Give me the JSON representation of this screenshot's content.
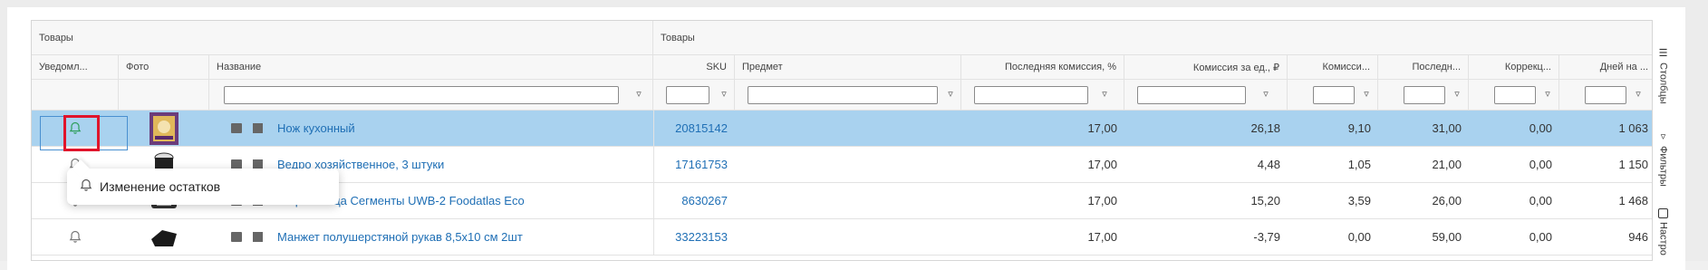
{
  "groups": {
    "left": "Товары",
    "right": "Товары"
  },
  "columns": {
    "notify": "Уведомл...",
    "photo": "Фото",
    "name": "Название",
    "sku": "SKU",
    "subject": "Предмет",
    "last_commission": "Последняя комиссия, %",
    "commission_per_unit": "Комиссия за ед., ₽",
    "commis": "Комисси...",
    "last": "Последн...",
    "correction": "Коррекц...",
    "days": "Дней на ..."
  },
  "rows": [
    {
      "name": "Нож кухонный",
      "sku": "20815142",
      "last_commission": "17,00",
      "commission_per_unit": "26,18",
      "commis": "9,10",
      "last": "31,00",
      "correction": "0,00",
      "days": "1 063",
      "selected": true
    },
    {
      "name": "Ведро хозяйственное, 3 штуки",
      "sku": "17161753",
      "last_commission": "17,00",
      "commission_per_unit": "4,48",
      "commis": "1,05",
      "last": "21,00",
      "correction": "0,00",
      "days": "1 150"
    },
    {
      "name": "Вафельница Сегменты UWB-2 Foodatlas Eco",
      "sku": "8630267",
      "last_commission": "17,00",
      "commission_per_unit": "15,20",
      "commis": "3,59",
      "last": "26,00",
      "correction": "0,00",
      "days": "1 468"
    },
    {
      "name": "Манжет полушерстяной рукав 8,5x10 см 2шт",
      "sku": "33223153",
      "last_commission": "17,00",
      "commission_per_unit": "-3,79",
      "commis": "0,00",
      "last": "59,00",
      "correction": "0,00",
      "days": "946"
    }
  ],
  "tooltip": "Изменение остатков",
  "sidebar": {
    "columns": "Столбцы",
    "filters": "Фильтры",
    "settings": "Настро"
  },
  "colors": {
    "selected_row": "#a9d2ef",
    "link": "#1f6fb5",
    "highlight": "#e0142b",
    "bell_active": "#2e9e5b"
  }
}
